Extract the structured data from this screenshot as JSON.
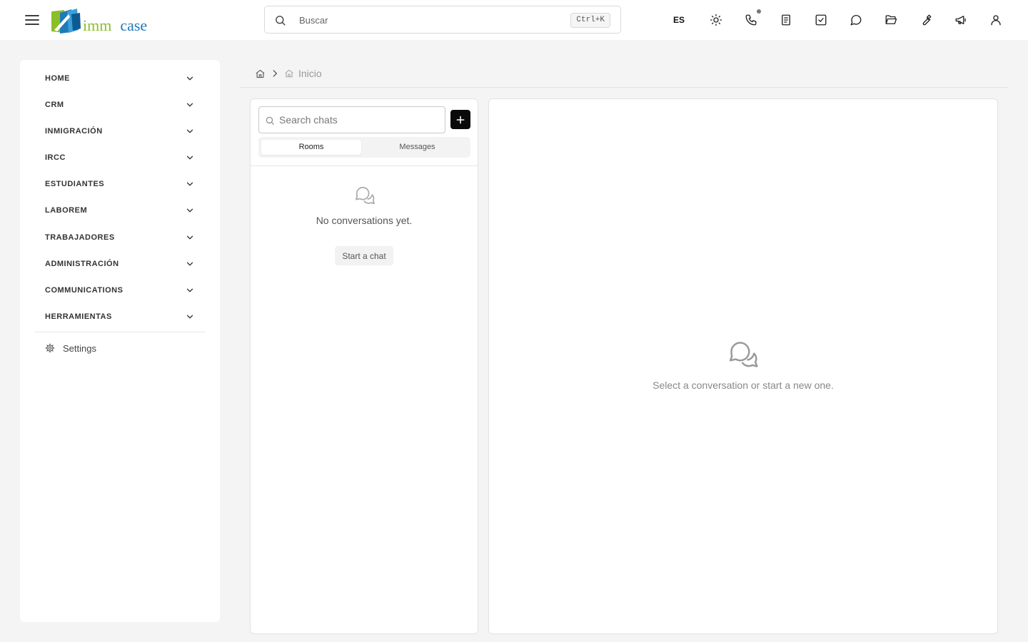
{
  "header": {
    "logo": {
      "part1": "imm",
      "part2": "case"
    },
    "search": {
      "placeholder": "Buscar",
      "shortcut": "Ctrl+K"
    },
    "language": "ES",
    "icons": [
      "sun-icon",
      "phone-icon",
      "notes-icon",
      "checkbox-icon",
      "chat-icon",
      "folder-open-icon",
      "wrench-icon",
      "megaphone-icon",
      "user-icon"
    ],
    "phone_indicator_color": "#777777"
  },
  "sidebar": {
    "items": [
      {
        "label": "HOME"
      },
      {
        "label": "CRM"
      },
      {
        "label": "INMIGRACIÓN"
      },
      {
        "label": "IRCC"
      },
      {
        "label": "ESTUDIANTES"
      },
      {
        "label": "LABOREM"
      },
      {
        "label": "TRABAJADORES"
      },
      {
        "label": "ADMINISTRACIÓN"
      },
      {
        "label": "COMMUNICATIONS"
      },
      {
        "label": "HERRAMIENTAS"
      }
    ],
    "settings_label": "Settings"
  },
  "breadcrumb": {
    "current": "Inicio"
  },
  "chat": {
    "search_placeholder": "Search chats",
    "tabs": [
      {
        "label": "Rooms",
        "active": true
      },
      {
        "label": "Messages",
        "active": false
      }
    ],
    "empty_text": "No conversations yet.",
    "start_label": "Start a chat",
    "conversation_placeholder": "Select a conversation or start a new one."
  },
  "colors": {
    "brand_green": "#8cbe2a",
    "brand_blue": "#1e7ab8",
    "accent_button": "#0a0a0a",
    "background": "#f4f4f4"
  }
}
